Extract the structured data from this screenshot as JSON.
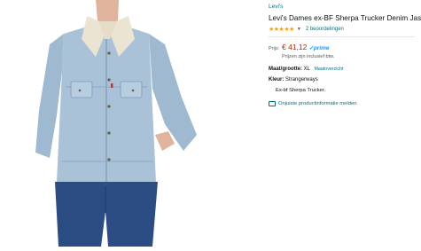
{
  "product": {
    "brand": "Levi's",
    "title": "Levi's Dames ex-BF Sherpa Trucker Denim Jas",
    "rating_stars": "★★★★★",
    "rating_chevron": "▼",
    "review_count": "2 beoordelingen",
    "price_label": "Prijs:",
    "price": "€ 41,12",
    "prime": "✓prime",
    "vat_note": "Prijzen zijn inclusief btw.",
    "size_label": "Maat/grootte:",
    "size_value": "XL",
    "size_chart_link": "Maatoverzicht",
    "color_label": "Kleur:",
    "color_value": "Strangerways",
    "bullets": [
      "Ex-bf Sherpa Trucker."
    ],
    "feedback_link": "Onjuiste productinformatie melden."
  },
  "colors": {
    "link": "#007185",
    "price": "#b12704",
    "star": "#f59c1a",
    "prime": "#1a98ff",
    "denim": "#a9c2d8",
    "sherpa": "#ece4d3"
  }
}
